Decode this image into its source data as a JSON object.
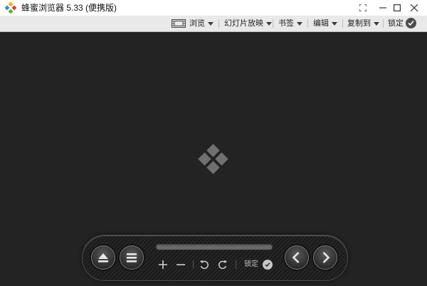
{
  "window": {
    "title": "蜂蜜浏览器 5.33 (便携版)"
  },
  "toolbar": {
    "browse_label": "浏览",
    "slideshow_label": "幻灯片放映",
    "bookmarks_label": "书签",
    "edit_label": "编辑",
    "copy_to_label": "复制到",
    "lock_label": "锁定"
  },
  "control_panel": {
    "lock_label": "锁定",
    "icons": [
      "eject-icon",
      "menu-icon",
      "zoom-in-icon",
      "zoom-out-icon",
      "rotate-left-icon",
      "rotate-right-icon",
      "previous-icon",
      "next-icon"
    ]
  },
  "colors": {
    "viewer_background": "#232323",
    "toolbar_background": "#e9e9e9"
  }
}
